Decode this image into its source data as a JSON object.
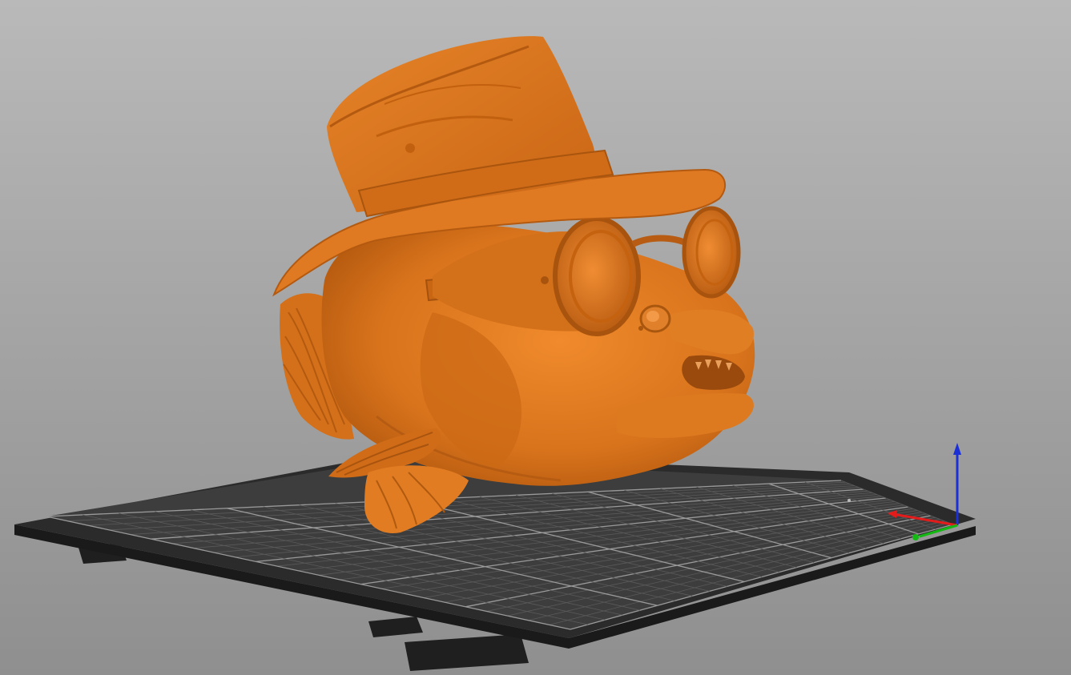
{
  "app": {
    "view": "3D preview",
    "colors": {
      "background_top": "#b9b9b9",
      "background_bottom": "#8f8f8f",
      "bed_surface": "#3c3c3c",
      "bed_frame": "#262626",
      "model": "#e07a1f",
      "axis_x": "#e31b1b",
      "axis_y": "#13b813",
      "axis_z": "#1a2fd6"
    }
  },
  "bed": {
    "logo_text": "",
    "icon": "print-bed-icon"
  },
  "model": {
    "icon": "fish-with-hat-and-goggles-model"
  },
  "axes": {
    "icon": "coordinate-axes-icon",
    "x_color": "#e31b1b",
    "y_color": "#13b813",
    "z_color": "#1a2fd6"
  }
}
